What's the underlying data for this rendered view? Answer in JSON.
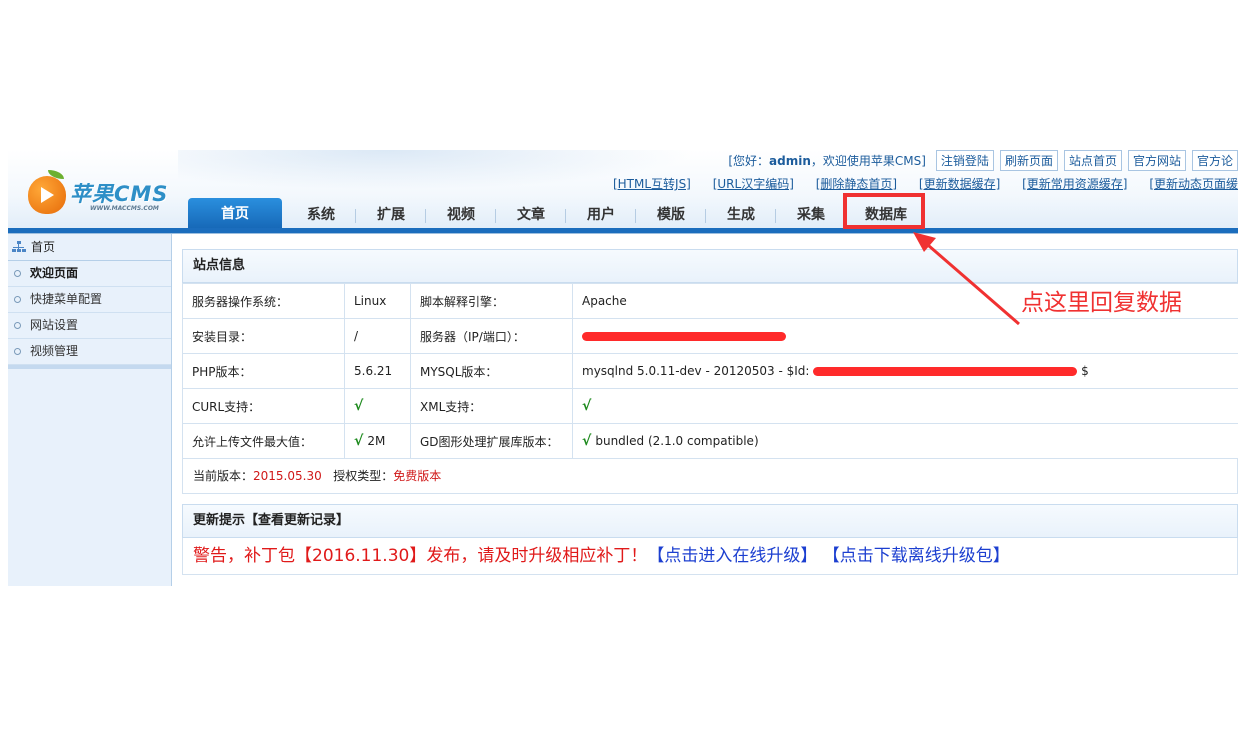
{
  "header": {
    "brand": "苹果CMS",
    "brand_sub": "WWW.MACCMS.COM",
    "welcome_prefix": "[您好：",
    "username": "admin",
    "welcome_suffix": "，欢迎使用苹果CMS]",
    "top_buttons": [
      "注销登陆",
      "刷新页面",
      "站点首页",
      "官方网站",
      "官方论"
    ],
    "quick_links": [
      "[HTML互转JS]",
      "[URL汉字编码]",
      "[删除静态首页]",
      "[更新数据缓存]",
      "[更新常用资源缓存]",
      "[更新动态页面缓"
    ]
  },
  "nav": {
    "tabs": [
      "首页",
      "系统",
      "扩展",
      "视频",
      "文章",
      "用户",
      "模版",
      "生成",
      "采集",
      "数据库"
    ],
    "active": "首页"
  },
  "sidebar": {
    "title": "首页",
    "items": [
      "欢迎页面",
      "快捷菜单配置",
      "网站设置",
      "视频管理"
    ]
  },
  "site_info": {
    "title": "站点信息",
    "rows": [
      {
        "k1": "服务器操作系统：",
        "v1": "Linux",
        "k2": "脚本解释引擎：",
        "v2": "Apache"
      },
      {
        "k1": "安装目录：",
        "v1": "/",
        "k2": "服务器（IP/端口）：",
        "v2": ""
      },
      {
        "k1": "PHP版本：",
        "v1": "5.6.21",
        "k2": "MYSQL版本：",
        "v2": "mysqlnd 5.0.11-dev - 20120503 - $Id:",
        "v2_tail": "$"
      },
      {
        "k1": "CURL支持：",
        "v1": "√",
        "k2": "XML支持：",
        "v2": "√"
      },
      {
        "k1": "允许上传文件最大值：",
        "v1_check": "√",
        "v1": "2M",
        "k2": "GD图形处理扩展库版本：",
        "v2_check": "√",
        "v2": "bundled (2.1.0 compatible)"
      }
    ],
    "version_label": "当前版本：",
    "version": "2015.05.30",
    "license_label": "授权类型：",
    "license": "免费版本"
  },
  "update": {
    "title": "更新提示【查看更新记录】",
    "warning_prefix": "警告，补丁包",
    "patch": "【2016.11.30】",
    "warning_mid": "发布，请及时升级相应补丁！",
    "online_link": "【点击进入在线升级】",
    "offline_link": "【点击下载离线升级包】"
  },
  "annotation": {
    "text": "点这里回复数据",
    "color": "#f03131"
  }
}
